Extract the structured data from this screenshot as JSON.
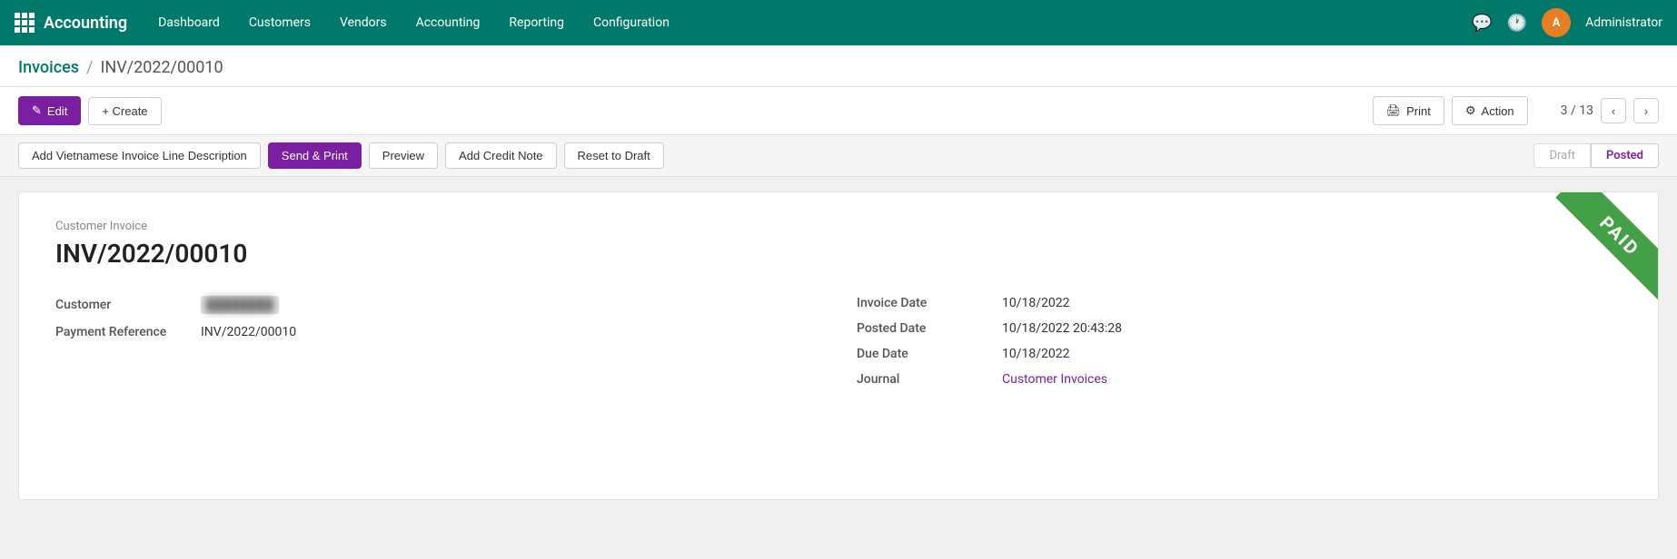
{
  "app": {
    "logo_text": "Accounting",
    "nav_items": [
      "Dashboard",
      "Customers",
      "Vendors",
      "Accounting",
      "Reporting",
      "Configuration"
    ]
  },
  "topnav_right": {
    "chat_icon": "💬",
    "clock_icon": "🕐",
    "avatar_initial": "A",
    "username": "Administrator"
  },
  "breadcrumb": {
    "parent_label": "Invoices",
    "separator": "/",
    "current": "INV/2022/00010"
  },
  "toolbar": {
    "edit_label": "Edit",
    "create_label": "+ Create",
    "print_label": "Print",
    "action_label": "Action",
    "pagination": "3 / 13"
  },
  "action_toolbar": {
    "btn_vietnamese": "Add Vietnamese Invoice Line Description",
    "btn_send_print": "Send & Print",
    "btn_preview": "Preview",
    "btn_add_credit": "Add Credit Note",
    "btn_reset_draft": "Reset to Draft",
    "status_draft": "Draft",
    "status_posted": "Posted"
  },
  "invoice": {
    "type": "Customer Invoice",
    "number": "INV/2022/00010",
    "paid_label": "PAID",
    "customer_label": "Customer",
    "customer_value": "██████████",
    "payment_ref_label": "Payment Reference",
    "payment_ref_value": "INV/2022/00010",
    "invoice_date_label": "Invoice Date",
    "invoice_date_value": "10/18/2022",
    "posted_date_label": "Posted Date",
    "posted_date_value": "10/18/2022 20:43:28",
    "due_date_label": "Due Date",
    "due_date_value": "10/18/2022",
    "journal_label": "Journal",
    "journal_value": "Customer Invoices"
  }
}
